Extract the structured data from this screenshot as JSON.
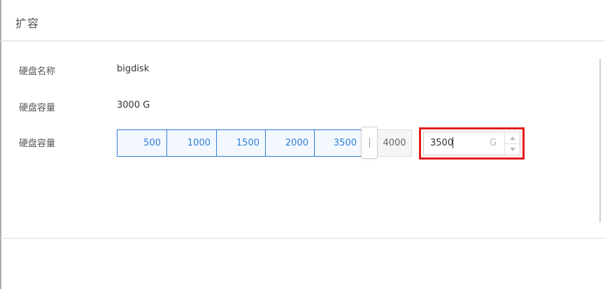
{
  "dialog": {
    "title": "扩容",
    "fields": {
      "disk_name_label": "硬盘名称",
      "disk_name_value": "bigdisk",
      "disk_capacity_label": "硬盘容量",
      "disk_capacity_value": "3000 G",
      "new_capacity_label": "硬盘容量"
    },
    "slider": {
      "segments": [
        "500",
        "1000",
        "1500",
        "2000",
        "3500",
        "4000"
      ],
      "selected_value": "3500",
      "accent_color": "#2f7dd8"
    },
    "capacity_input": {
      "value": "3500",
      "unit": "G"
    },
    "highlight_color": "#e51c1c"
  }
}
